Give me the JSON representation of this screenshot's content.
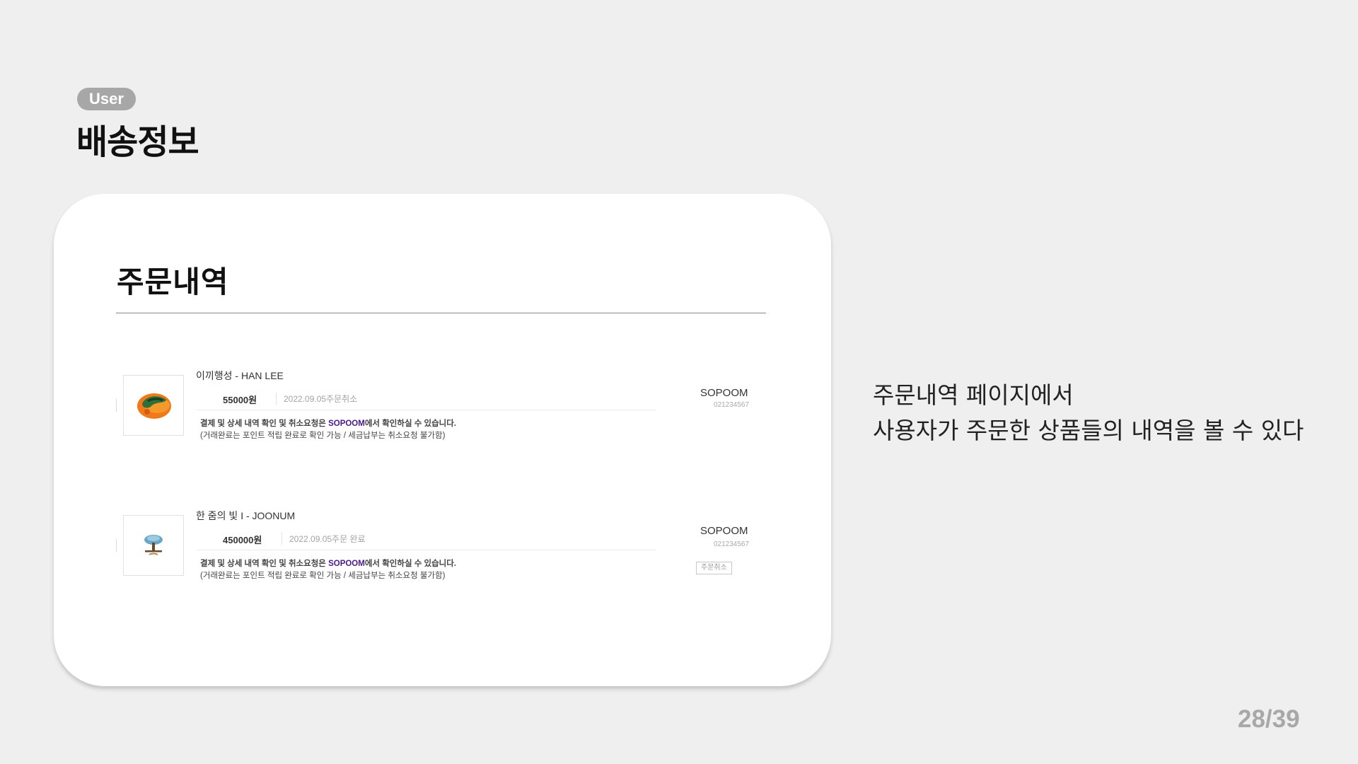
{
  "header": {
    "tag": "User",
    "title": "배송정보"
  },
  "card": {
    "title": "주문내역",
    "orders": [
      {
        "product": "이끼행성 - HAN LEE",
        "price": "55000원",
        "date_status": "2022.09.05주문취소",
        "note_line1_pre": "결제 및 상세 내역 확인 및 취소요청은 ",
        "note_brand": "SOPOOM",
        "note_line1_post": "에서 확인하실 수 있습니다.",
        "note_line2": "(거래완료는 포인트 적립 완료로 확인 가능 / 세금납부는 취소요청 불가함)",
        "seller": "SOPOOM",
        "code": "021234567",
        "thumb_icon": "moss-planet-thumbnail"
      },
      {
        "product": "한 줌의 빛 I - JOONUM",
        "price": "450000원",
        "date_status": "2022.09.05주문 완료",
        "note_line1_pre": "결제 및 상세 내역 확인 및 취소요청은 ",
        "note_brand": "SOPOOM",
        "note_line1_post": "에서 확인하실 수 있습니다.",
        "note_line2": "(거래완료는 포인트 적립 완료로 확인 가능 / 세금납부는 취소요청 불가함)",
        "seller": "SOPOOM",
        "code": "021234567",
        "cancel_label": "주문취소",
        "thumb_icon": "tree-artwork-thumbnail"
      }
    ]
  },
  "description": {
    "line1": "주문내역 페이지에서",
    "line2": "사용자가 주문한 상품들의 내역을 볼 수 있다"
  },
  "pager": "28/39",
  "colors": {
    "background": "#efefef",
    "tag": "#a7a7a7",
    "brand": "#4a1a8c"
  }
}
